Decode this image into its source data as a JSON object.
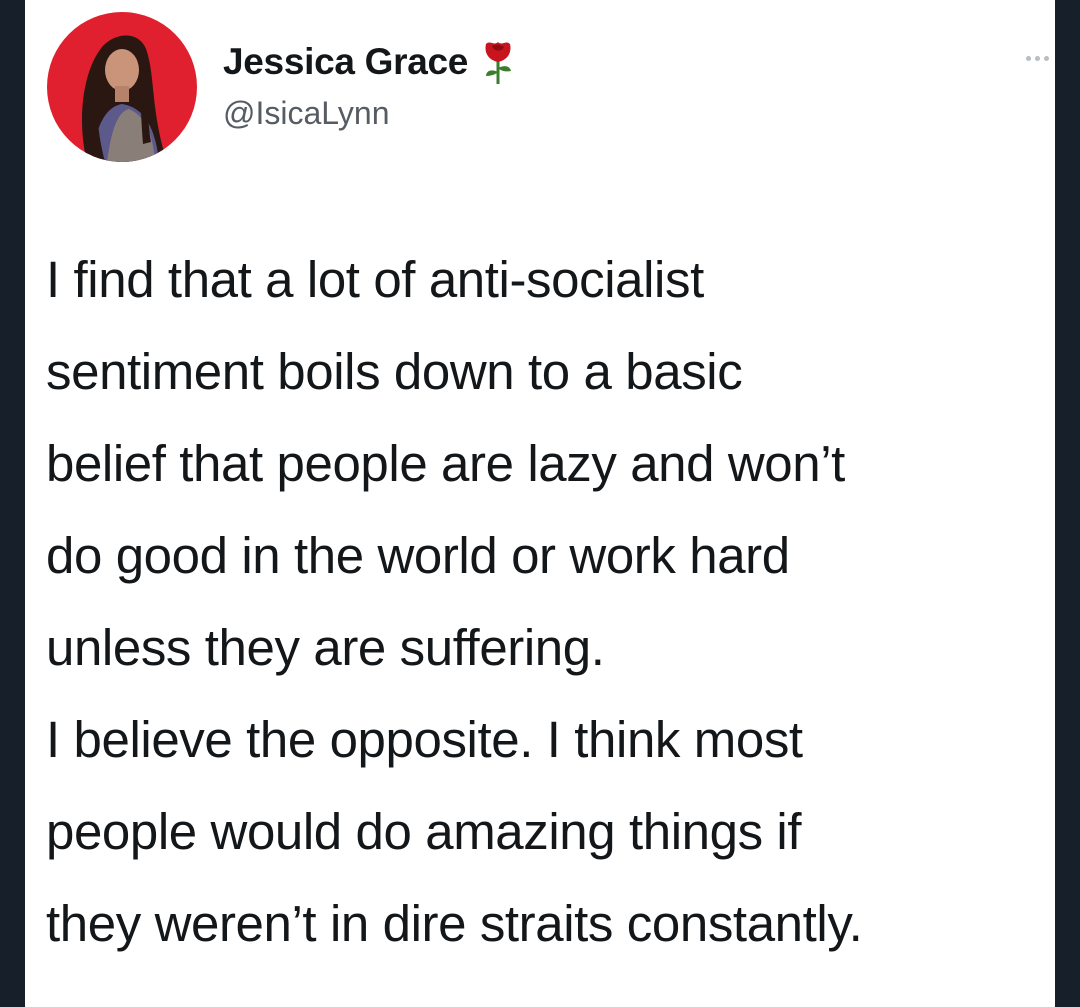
{
  "author": {
    "display_name": "Jessica Grace",
    "handle": "@IsicaLynn",
    "badge_icon": "rose-icon",
    "avatar_bg": "#e0202e"
  },
  "menu": {
    "icon": "more-icon"
  },
  "tweet": {
    "paragraph1": {
      "line1": "I find that a lot of anti-socialist",
      "line2": "sentiment boils down to a basic",
      "line3": "belief that people are lazy and won’t",
      "line4": "do good in the world or work hard",
      "line5": "unless they are suffering."
    },
    "paragraph2": {
      "line1": "I believe the opposite. I think most",
      "line2": "people would do amazing things if",
      "line3": "they weren’t in dire straits constantly."
    }
  }
}
